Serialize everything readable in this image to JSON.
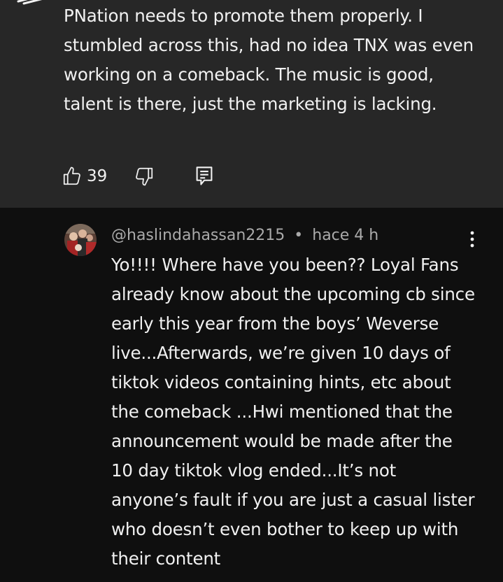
{
  "comments": [
    {
      "text": "PNation needs to promote them properly. I stumbled across this, had no idea TNX was even working on a comeback. The music is good, talent is there, just the marketing is lacking.",
      "likes": "39",
      "icons": {
        "like": "thumbs-up-icon",
        "dislike": "thumbs-down-icon",
        "reply": "reply-icon"
      }
    },
    {
      "author": "@haslindahassan2215",
      "separator": "•",
      "time": "hace 4 h",
      "text": "Yo!!!! Where have you been?? Loyal Fans already know about the upcoming cb since early this year from the boys’ Weverse live...Afterwards, we’re given 10 days of tiktok videos containing hints, etc about the comeback ...Hwi mentioned that the announcement would be made after the 10 day tiktok vlog ended...It’s not anyone’s fault if you are just a casual lister who doesn’t even bother to keep up with their content",
      "icons": {
        "menu": "more-vertical-icon",
        "avatar": "avatar"
      }
    }
  ],
  "colors": {
    "highlighted_comment_bg": "#272727",
    "page_bg": "#0f0f0f",
    "text": "#f1f1f1",
    "meta_text": "#aaaaaa"
  }
}
